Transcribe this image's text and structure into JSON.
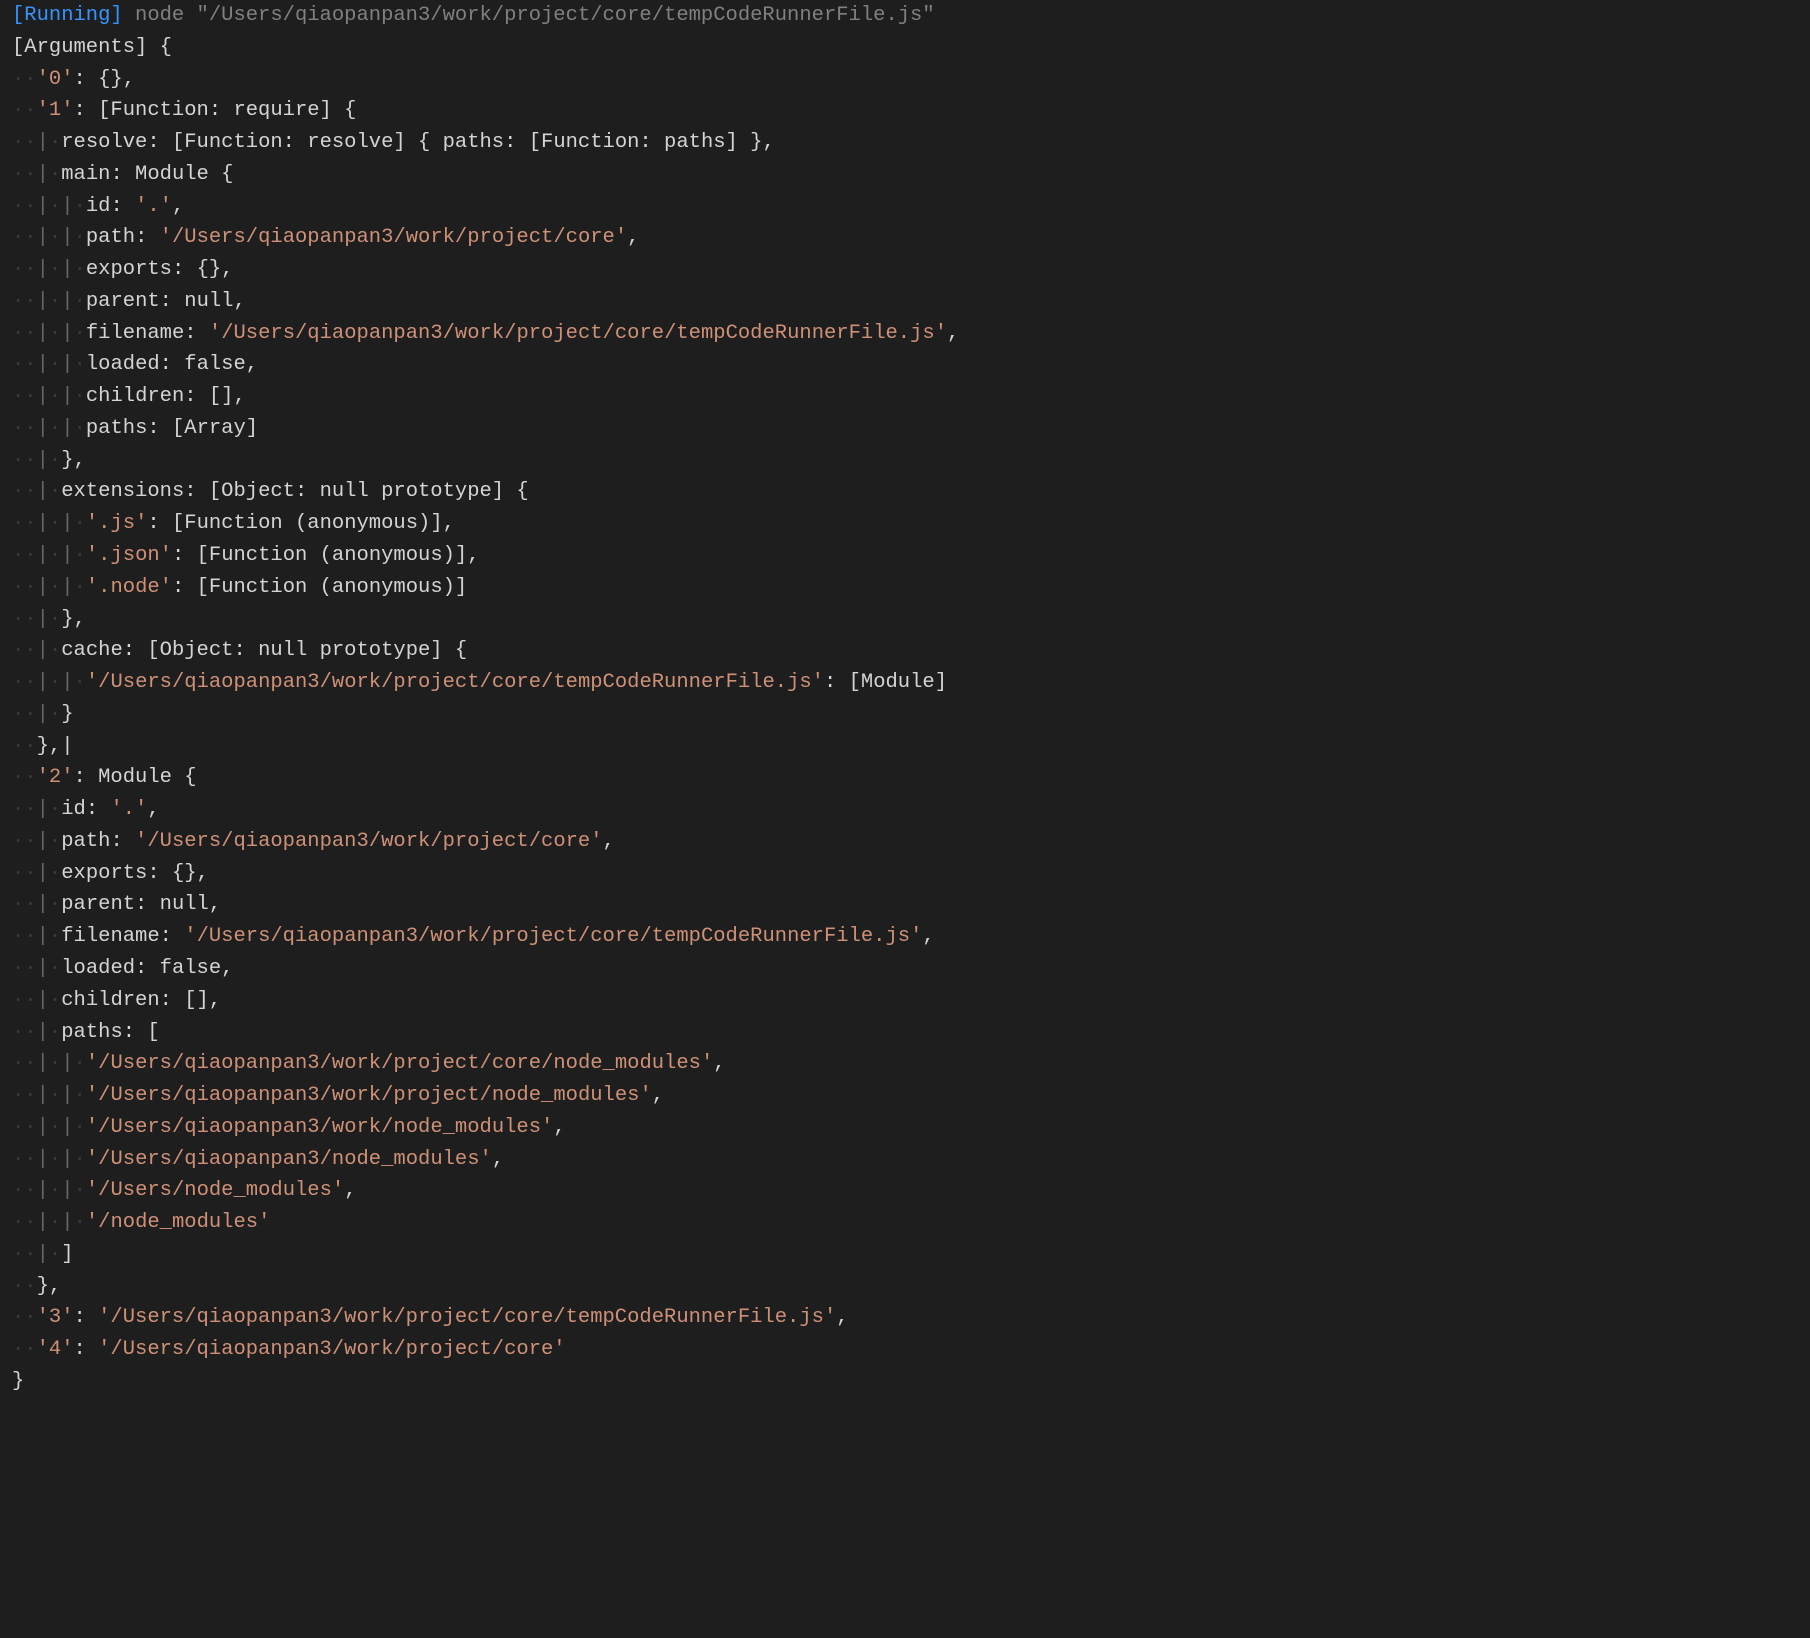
{
  "header": {
    "running_label": "[Running]",
    "command": "node \"/Users/qiaopanpan3/work/project/core/tempCodeRunnerFile.js\""
  },
  "lines": [
    "[Arguments] {",
    "  '0': {},",
    "  '1': [Function: require] {",
    "    resolve: [Function: resolve] { paths: [Function: paths] },",
    "    main: Module {",
    "      id: '.',",
    "      path: '/Users/qiaopanpan3/work/project/core',",
    "      exports: {},",
    "      parent: null,",
    "      filename: '/Users/qiaopanpan3/work/project/core/tempCodeRunnerFile.js',",
    "      loaded: false,",
    "      children: [],",
    "      paths: [Array]",
    "    },",
    "    extensions: [Object: null prototype] {",
    "      '.js': [Function (anonymous)],",
    "      '.json': [Function (anonymous)],",
    "      '.node': [Function (anonymous)]",
    "    },",
    "    cache: [Object: null prototype] {",
    "      '/Users/qiaopanpan3/work/project/core/tempCodeRunnerFile.js': [Module]",
    "    }",
    "  },",
    "  '2': Module {",
    "    id: '.',",
    "    path: '/Users/qiaopanpan3/work/project/core',",
    "    exports: {},",
    "    parent: null,",
    "    filename: '/Users/qiaopanpan3/work/project/core/tempCodeRunnerFile.js',",
    "    loaded: false,",
    "    children: [],",
    "    paths: [",
    "      '/Users/qiaopanpan3/work/project/core/node_modules',",
    "      '/Users/qiaopanpan3/work/project/node_modules',",
    "      '/Users/qiaopanpan3/work/node_modules',",
    "      '/Users/qiaopanpan3/node_modules',",
    "      '/Users/node_modules',",
    "      '/node_modules'",
    "    ]",
    "  },",
    "  '3': '/Users/qiaopanpan3/work/project/core/tempCodeRunnerFile.js',",
    "  '4': '/Users/qiaopanpan3/work/project/core'",
    "}"
  ],
  "indent_guides": [
    0,
    1,
    1,
    2,
    2,
    3,
    3,
    3,
    3,
    3,
    3,
    3,
    3,
    2,
    2,
    3,
    3,
    3,
    2,
    2,
    3,
    2,
    1,
    1,
    2,
    2,
    2,
    2,
    2,
    2,
    2,
    2,
    3,
    3,
    3,
    3,
    3,
    3,
    2,
    1,
    1,
    1,
    0
  ],
  "cursor_line_index": 22
}
